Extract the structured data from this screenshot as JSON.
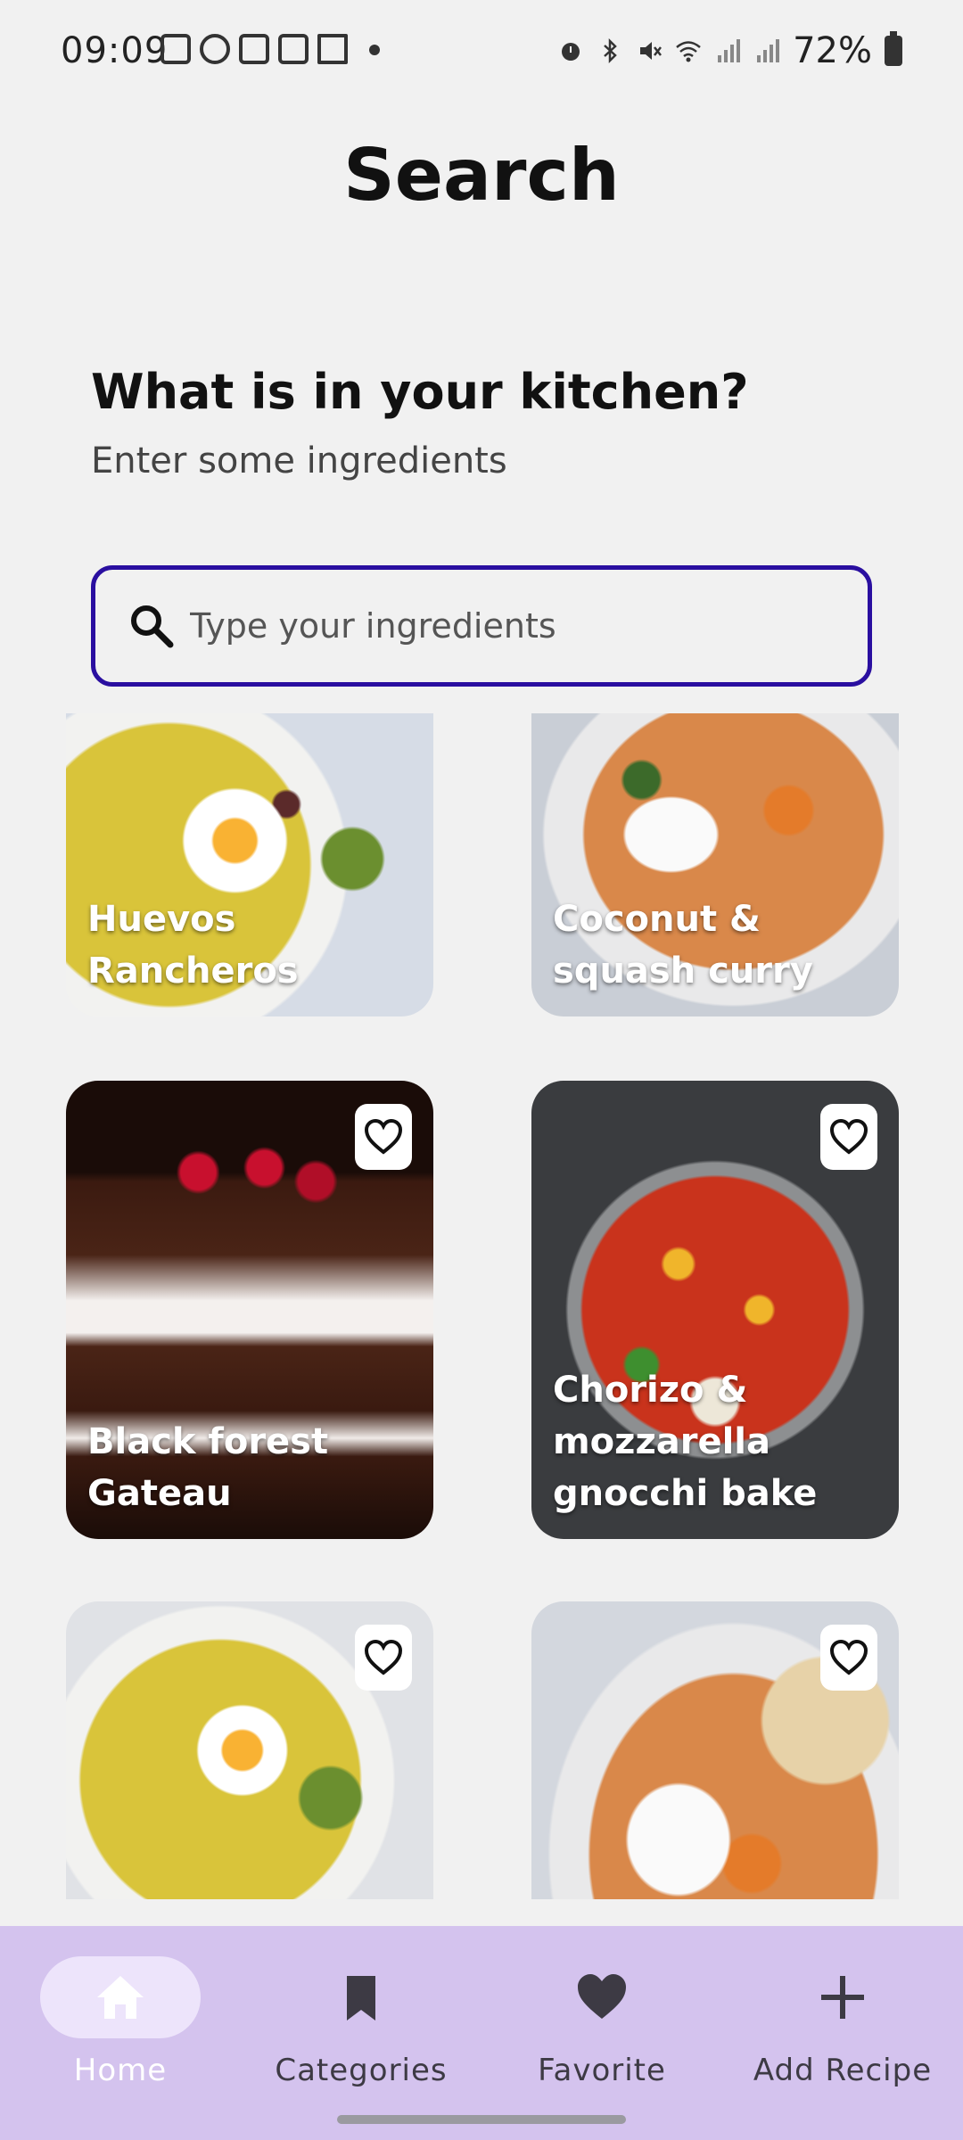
{
  "status_bar": {
    "time": "09:09",
    "battery": "72%",
    "left_icons": [
      "snapchat-icon",
      "whatsapp-icon",
      "cart-icon",
      "instagram-icon",
      "jiji-icon",
      "dot-icon"
    ],
    "right_icons": [
      "alarm-icon",
      "bluetooth-icon",
      "mute-icon",
      "wifi-icon",
      "signal-icon",
      "signal-icon",
      "battery-icon"
    ]
  },
  "header": {
    "title": "Search"
  },
  "prompt": {
    "question": "What is in your kitchen?",
    "subtitle": "Enter some ingredients"
  },
  "search": {
    "placeholder": "Type your ingredients",
    "value": "",
    "border_color": "#2a0fa0"
  },
  "recipes": [
    {
      "title": "Huevos Rancheros",
      "favorite_icon": "heart-outline-icon"
    },
    {
      "title": "Coconut & squash curry",
      "favorite_icon": "heart-outline-icon"
    },
    {
      "title": "Black forest Gateau",
      "favorite_icon": "heart-outline-icon"
    },
    {
      "title": "Chorizo & mozzarella gnocchi bake",
      "favorite_icon": "heart-outline-icon"
    },
    {
      "title": "",
      "favorite_icon": "heart-outline-icon"
    },
    {
      "title": "",
      "favorite_icon": "heart-outline-icon"
    }
  ],
  "bottom_nav": {
    "background": "#d4c3ee",
    "items": [
      {
        "label": "Home",
        "icon": "home-icon",
        "active": true
      },
      {
        "label": "Categories",
        "icon": "bookmark-icon",
        "active": false
      },
      {
        "label": "Favorite",
        "icon": "heart-icon",
        "active": false
      },
      {
        "label": "Add Recipe",
        "icon": "plus-icon",
        "active": false
      }
    ]
  }
}
